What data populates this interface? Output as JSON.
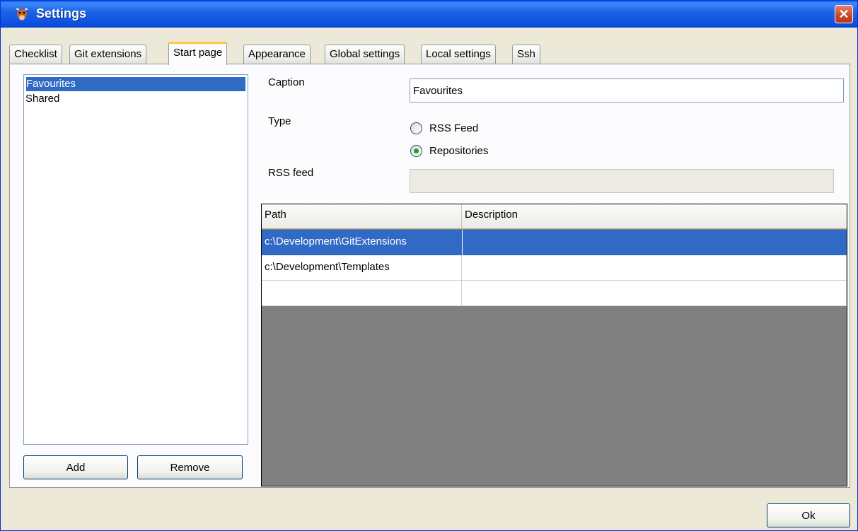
{
  "window": {
    "title": "Settings",
    "close_symbol": "✕"
  },
  "tabs": [
    "Checklist",
    "Git extensions",
    "Start page",
    "Appearance",
    "Global settings",
    "Local settings",
    "Ssh"
  ],
  "active_tab": "Start page",
  "categories": {
    "items": [
      "Favourites",
      "Shared"
    ],
    "selected": "Favourites"
  },
  "buttons": {
    "add": "Add",
    "remove": "Remove",
    "ok": "Ok"
  },
  "form": {
    "caption_label": "Caption",
    "caption_value": "Favourites",
    "type_label": "Type",
    "type_options": [
      "RSS Feed",
      "Repositories"
    ],
    "type_selected": "Repositories",
    "rss_label": "RSS feed",
    "rss_value": ""
  },
  "grid": {
    "columns": [
      "Path",
      "Description"
    ],
    "rows": [
      [
        "c:\\Development\\GitExtensions",
        ""
      ],
      [
        "c:\\Development\\Templates",
        ""
      ],
      [
        "",
        ""
      ]
    ],
    "selected_row": 0
  },
  "colors": {
    "titlebar": "#0b4ee0",
    "selection": "#316ac5",
    "active_tab_accent": "#ffc83c",
    "radio_dot": "#21a121"
  },
  "icons": {
    "app": "git-extensions-cow-icon",
    "close": "close-icon"
  }
}
